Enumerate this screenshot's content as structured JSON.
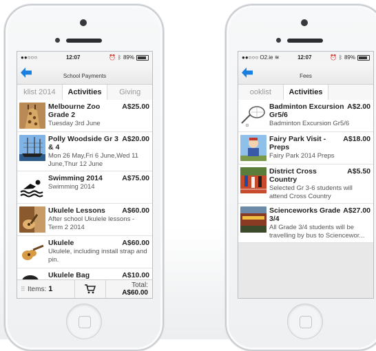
{
  "phone_left": {
    "status": {
      "carrier": "●●○○○",
      "time": "12:07",
      "battery": "89%"
    },
    "nav": {
      "title": "School Payments"
    },
    "tabs": [
      {
        "label": "klist 2014",
        "active": false
      },
      {
        "label": "Activities",
        "active": true
      },
      {
        "label": "Giving",
        "active": false
      }
    ],
    "items": [
      {
        "name": "Melbourne Zoo Grade 2",
        "price": "A$25.00",
        "desc": "Tuesday 3rd June",
        "thumb": "giraffe-thumb"
      },
      {
        "name": "Polly Woodside Gr 3 & 4",
        "price": "A$20.00",
        "desc": "Mon 26 May,Fri 6 June,Wed 11 June,Thur 12 June",
        "thumb": "ship-thumb"
      },
      {
        "name": "Swimming 2014",
        "price": "A$75.00",
        "desc": "Swimming 2014",
        "thumb": "swimmer-thumb"
      },
      {
        "name": "Ukulele Lessons",
        "price": "A$60.00",
        "desc": "After school Ukulele lessons - Term 2 2014",
        "thumb": "ukulele-player-thumb"
      },
      {
        "name": "Ukulele",
        "price": "A$60.00",
        "desc": "Ukulele, including install strap and pin.",
        "thumb": "ukulele-thumb"
      },
      {
        "name": "Ukulele Bag",
        "price": "A$10.00",
        "desc": "",
        "thumb": "bag-thumb"
      }
    ],
    "footer": {
      "items_label": "Items:",
      "items_count": "1",
      "total_label": "Total:",
      "total_value": "A$60.00"
    }
  },
  "phone_right": {
    "status": {
      "carrier": "●●○○○ O2.ie",
      "time": "12:07",
      "battery": "89%"
    },
    "nav": {
      "title": "Fees"
    },
    "tabs": [
      {
        "label": "ooklist",
        "active": false
      },
      {
        "label": "Activities",
        "active": true
      },
      {
        "label": "",
        "active": false
      }
    ],
    "items": [
      {
        "name": "Badminton Excursion Gr5/6",
        "price": "A$2.00",
        "desc": "Badminton Excursion Gr5/6",
        "thumb": "racquet-thumb"
      },
      {
        "name": "Fairy Park Visit - Preps",
        "price": "A$18.00",
        "desc": "Fairy Park 2014 Preps",
        "thumb": "fairy-park-thumb"
      },
      {
        "name": "District Cross Country",
        "price": "A$5.50",
        "desc": "Selected Gr 3-6 students will attend Cross Country",
        "thumb": "runners-thumb"
      },
      {
        "name": "Scienceworks Grade 3/4",
        "price": "A$27.00",
        "desc": "All Grade 3/4 students will be travelling by bus to Sciencewor...",
        "thumb": "scienceworks-thumb"
      }
    ]
  },
  "colors": {
    "accent": "#1b7fe0",
    "text": "#222222"
  }
}
